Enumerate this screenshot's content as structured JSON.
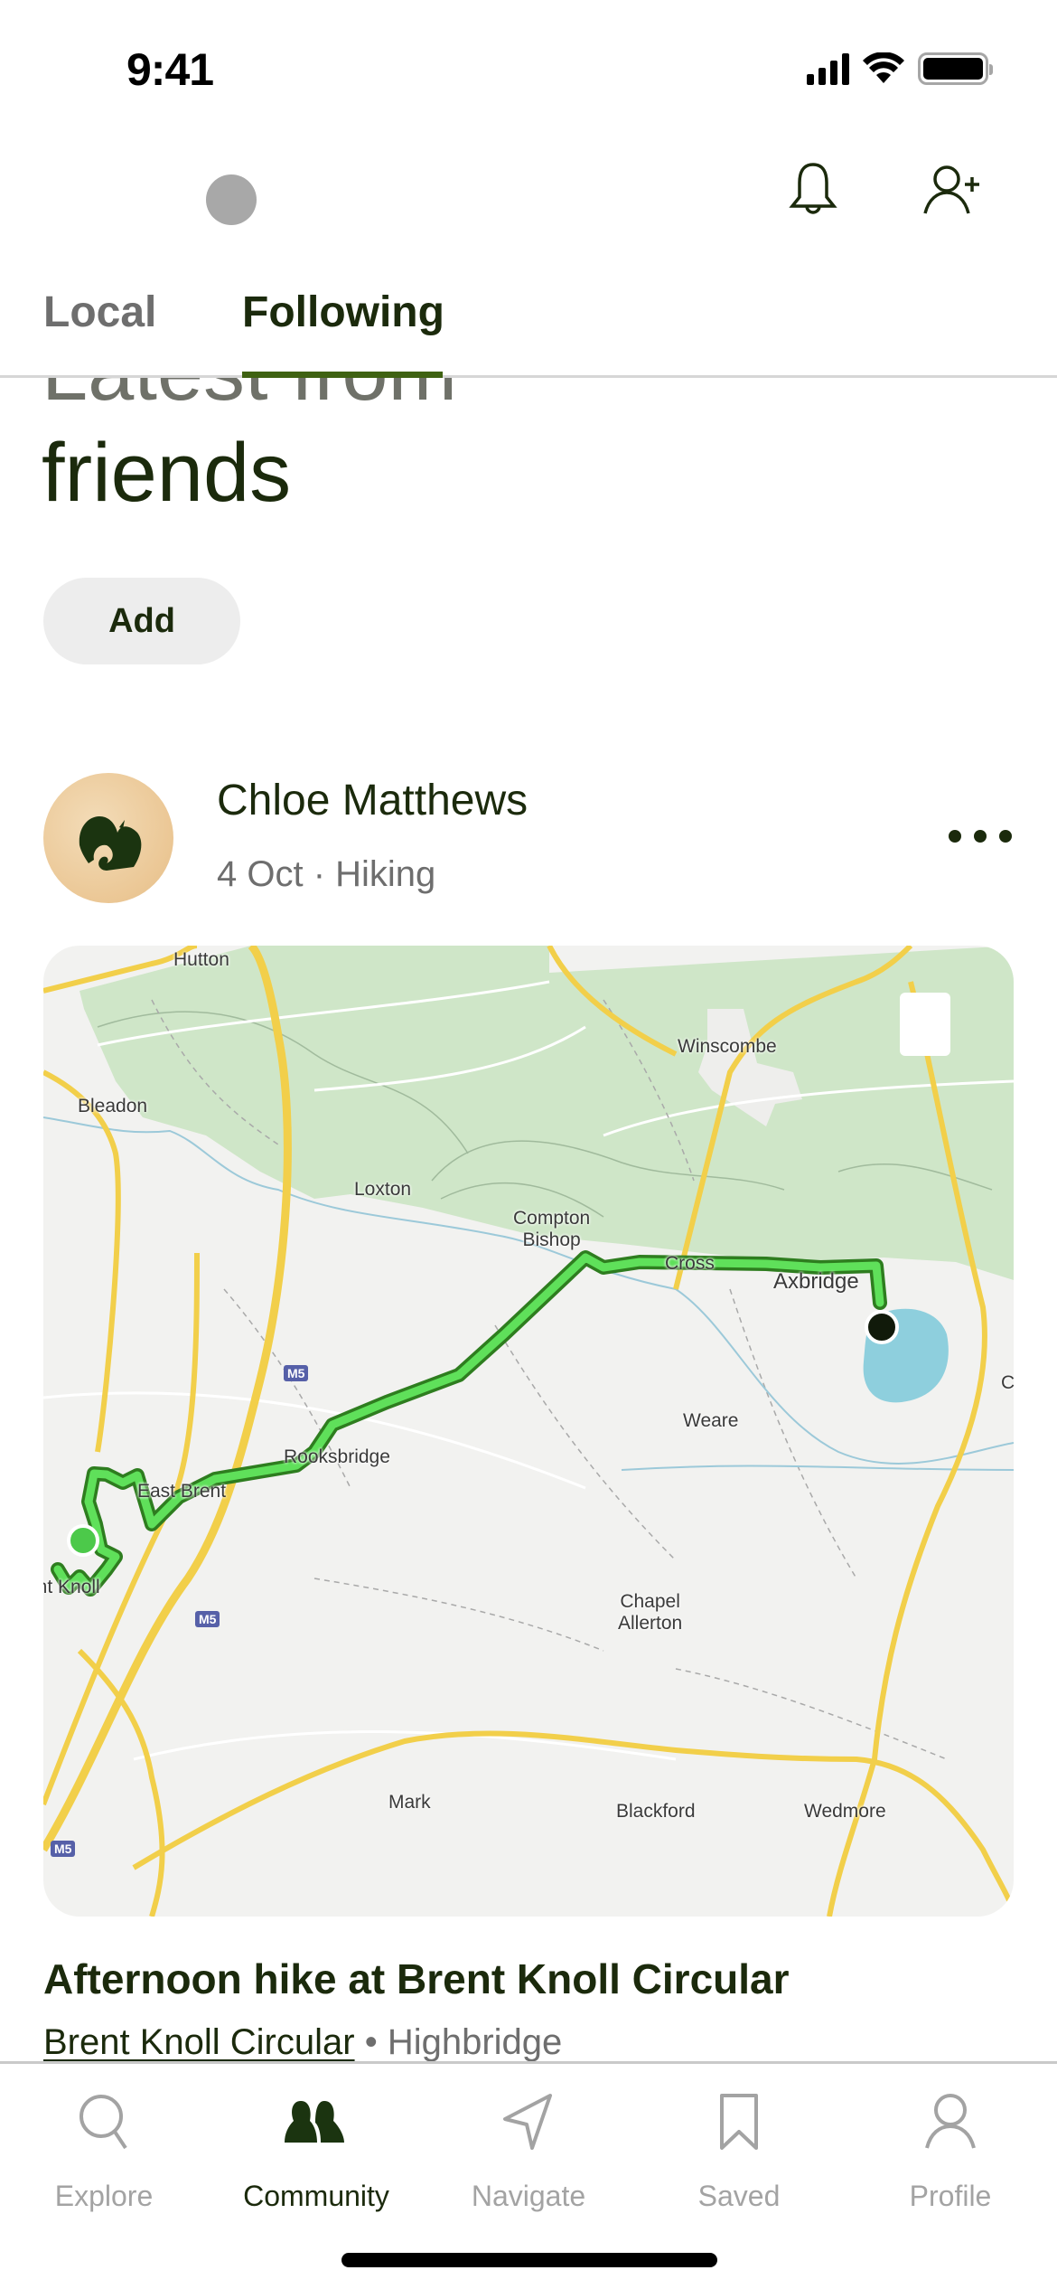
{
  "status_bar": {
    "time": "9:41"
  },
  "header": {
    "icons": [
      "bell-icon",
      "add-user-icon"
    ]
  },
  "tabs": [
    {
      "label": "Local",
      "active": false
    },
    {
      "label": "Following",
      "active": true
    }
  ],
  "section": {
    "title_line1": "Latest from",
    "title_line2": "friends",
    "add_button": "Add"
  },
  "post": {
    "author": "Chloe Matthews",
    "meta": "4 Oct · Hiking",
    "title": "Afternoon hike at Brent Knoll Circular",
    "trail_link": "Brent Knoll Circular",
    "separator": " • ",
    "location": "Highbridge",
    "map": {
      "labels": [
        {
          "text": "Hutton"
        },
        {
          "text": "Winscombe"
        },
        {
          "text": "Bleadon"
        },
        {
          "text": "Loxton"
        },
        {
          "text": "Compton\nBishop"
        },
        {
          "text": "Cross"
        },
        {
          "text": "Axbridge"
        },
        {
          "text": "Weare"
        },
        {
          "text": "Rooksbridge"
        },
        {
          "text": "East Brent"
        },
        {
          "text": "Brent Knoll"
        },
        {
          "text": "Chapel\nAllerton"
        },
        {
          "text": "Mark"
        },
        {
          "text": "Blackford"
        },
        {
          "text": "Wedmore"
        },
        {
          "text": "C"
        }
      ],
      "road_shields": [
        "M5",
        "M5",
        "M5"
      ],
      "colors": {
        "route": "#5fe05a",
        "route_outline": "#2e7d1f",
        "forest": "#cfe6c8",
        "land": "#f2f2f0",
        "road": "#f2cf4a",
        "water": "#8ecfdd"
      }
    }
  },
  "bottom_nav": [
    {
      "label": "Explore",
      "icon": "search-icon",
      "active": false
    },
    {
      "label": "Community",
      "icon": "community-icon",
      "active": true
    },
    {
      "label": "Navigate",
      "icon": "navigate-icon",
      "active": false
    },
    {
      "label": "Saved",
      "icon": "bookmark-icon",
      "active": false
    },
    {
      "label": "Profile",
      "icon": "profile-icon",
      "active": false
    }
  ],
  "theme": {
    "accent": "#3f6212",
    "text_dark": "#1b2a0c",
    "muted": "#6e6e6e"
  }
}
